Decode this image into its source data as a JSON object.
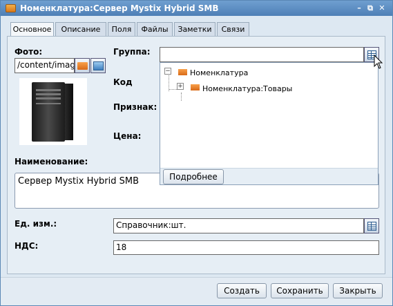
{
  "window": {
    "title": "Номенклатура:Сервер Mystix Hybrid SMB",
    "minimize_glyph": "–",
    "maximize_glyph": "⧉",
    "close_glyph": "✕"
  },
  "tabs": [
    {
      "label": "Основное",
      "active": true
    },
    {
      "label": "Описание",
      "active": false
    },
    {
      "label": "Поля",
      "active": false
    },
    {
      "label": "Файлы",
      "active": false
    },
    {
      "label": "Заметки",
      "active": false
    },
    {
      "label": "Связи",
      "active": false
    }
  ],
  "form": {
    "photo_label": "Фото:",
    "photo_path": "/content/image",
    "group_label": "Группа:",
    "group_value": "",
    "code_label": "Код",
    "attribute_label": "Признак:",
    "price_label": "Цена:",
    "name_label": "Наименование:",
    "name_value": "Сервер Mystix Hybrid SMB",
    "unit_label": "Ед. изм.:",
    "unit_value": "Справочник:шт.",
    "vat_label": "НДС:",
    "vat_value": "18"
  },
  "group_dropdown": {
    "tree": [
      {
        "label": "Номенклатура",
        "toggle": "−"
      },
      {
        "label": "Номенклатура:Товары",
        "toggle": "+"
      }
    ],
    "details_button": "Подробнее"
  },
  "footer": {
    "create": "Создать",
    "save": "Сохранить",
    "close": "Закрыть"
  },
  "colors": {
    "titlebar": "#4e7fb6",
    "window_bg": "#dde8f2",
    "folder_accent": "#d86a18"
  },
  "icons": [
    "folder-icon",
    "picture-icon",
    "catalog-icon",
    "tower-server-icon",
    "mouse-cursor-icon"
  ]
}
